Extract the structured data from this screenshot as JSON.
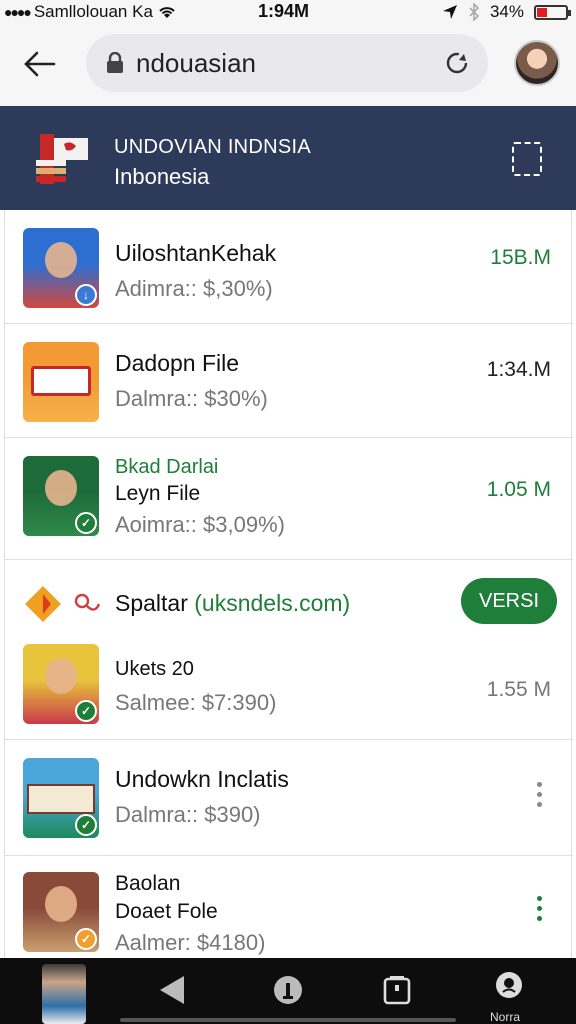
{
  "status_bar": {
    "carrier": "Samllolouan Ka",
    "time": "1:94M",
    "battery": "34%",
    "battery_level": 0.34
  },
  "browser": {
    "url": "ndouasian"
  },
  "banner": {
    "title": "UNDOVIAN INDNSIA",
    "subtitle": "Inbonesia"
  },
  "items": [
    {
      "title": "UiloshtanKehak",
      "subtitle": "Adimra:: $,30%)",
      "size": "15B.M",
      "size_color": "green",
      "thumb_colors": [
        "#2c6fd1",
        "#d3473f"
      ],
      "check_color": "#3a7bd5",
      "check_icon": "download-icon"
    },
    {
      "title": "Dadopn File",
      "subtitle": "Dalmra:: $30%)",
      "size": "1:34.M",
      "size_color": "dark",
      "thumb_colors": [
        "#f39a35",
        "#f7b24a"
      ],
      "check_color": "",
      "check_icon": ""
    },
    {
      "title": "Bkad Darlai",
      "title_color": "#1e7e3a",
      "subtitle_line": "Leyn File",
      "subtitle": "Aoimra:: $3,09%)",
      "size": "1.05 M",
      "size_color": "green",
      "thumb_colors": [
        "#1e6b3a",
        "#2e8a4a"
      ],
      "check_color": "#1e7e3a",
      "check_icon": "check-icon"
    },
    {
      "app_name": "Spaltar",
      "app_domain": "(uksndels.com)",
      "button": "VERSI",
      "title": "Ukets 20",
      "subtitle": "Salmee: $7:390)",
      "size": "1.55 M",
      "size_color": "grey",
      "thumb_colors": [
        "#e8c33c",
        "#c83a4a"
      ],
      "check_color": "#1e7e3a",
      "check_icon": "check-icon"
    },
    {
      "title": "Undowkn Inclatis",
      "subtitle": "Dalmra:: $390)",
      "thumb_colors": [
        "#4aa6d8",
        "#1e8a5a"
      ],
      "check_color": "#1e7e3a",
      "check_icon": "check-icon",
      "menu": "more-vertical-icon",
      "menu_color": "#888888"
    },
    {
      "title": "Baolan",
      "subtitle_line": "Doaet Fole",
      "subtitle": "Aalmer: $4180)",
      "thumb_colors": [
        "#8a4a3a",
        "#c9a070"
      ],
      "check_color": "#f0a030",
      "check_icon": "check-icon",
      "menu": "more-vertical-icon",
      "menu_color": "#1e7e3a"
    }
  ],
  "bottom_nav": {
    "label": "Norra"
  },
  "colors": {
    "banner_bg": "#2d3a5a",
    "accent_green": "#1e7e3a"
  }
}
